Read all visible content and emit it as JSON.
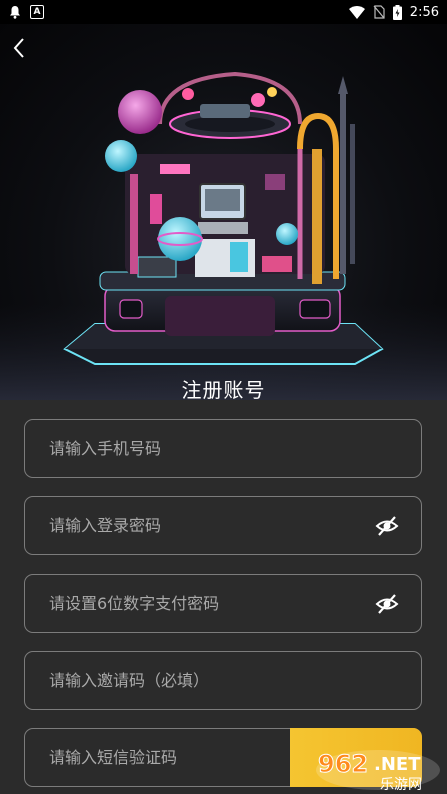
{
  "status_bar": {
    "time": "2:56",
    "icons": [
      "notification-bell-icon",
      "text-a-icon",
      "wifi-icon",
      "no-sim-icon",
      "battery-charging-icon"
    ]
  },
  "header": {
    "back_icon": "chevron-left-icon",
    "title": "注册账号"
  },
  "form": {
    "phone_placeholder": "请输入手机号码",
    "login_password_placeholder": "请输入登录密码",
    "pay_password_placeholder": "请设置6位数字支付密码",
    "invite_code_placeholder": "请输入邀请码（必填）",
    "sms_code_placeholder": "请输入短信验证码",
    "send_code_label": "",
    "eye_icon": "eye-off-icon"
  },
  "watermark": {
    "line1": "962.NET",
    "line2": "乐游网"
  },
  "colors": {
    "background": "#2b2b2b",
    "field_border": "#7c7c7c",
    "placeholder": "#a9a9a9",
    "accent_yellow": "#f5c531"
  }
}
